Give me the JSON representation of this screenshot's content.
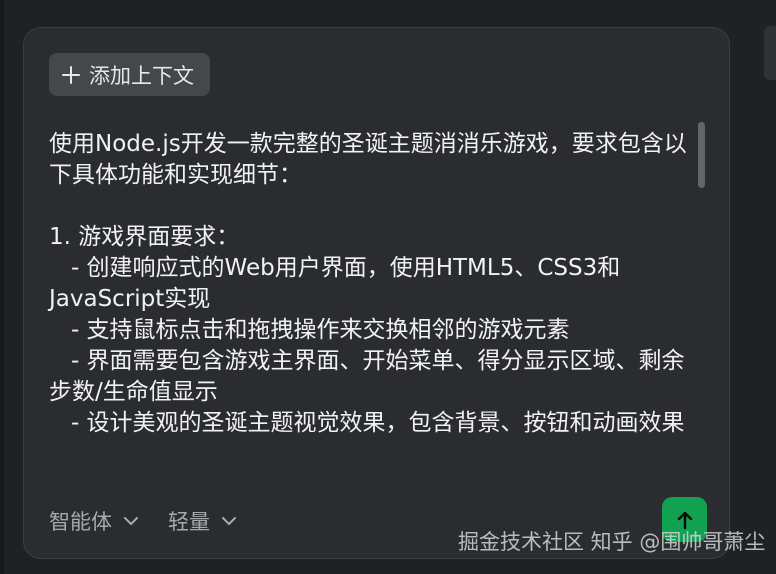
{
  "context_button": {
    "label": "添加上下文",
    "icon": "plus-icon"
  },
  "prompt": {
    "text": "使用Node.js开发一款完整的圣诞主题消消乐游戏，要求包含以下具体功能和实现细节：\n\n1. 游戏界面要求：\n   - 创建响应式的Web用户界面，使用HTML5、CSS3和JavaScript实现\n   - 支持鼠标点击和拖拽操作来交换相邻的游戏元素\n   - 界面需要包含游戏主界面、开始菜单、得分显示区域、剩余步数/生命值显示\n   - 设计美观的圣诞主题视觉效果，包含背景、按钮和动画效果"
  },
  "toolbar": {
    "agent_label": "智能体",
    "mode_label": "轻量",
    "send_icon": "arrow-up-icon"
  },
  "watermark": {
    "text": "掘金技术社区 知乎 @围帅哥萧尘"
  },
  "colors": {
    "background": "#1f2124",
    "panel": "#2a2c30",
    "send_button": "#12a150"
  }
}
